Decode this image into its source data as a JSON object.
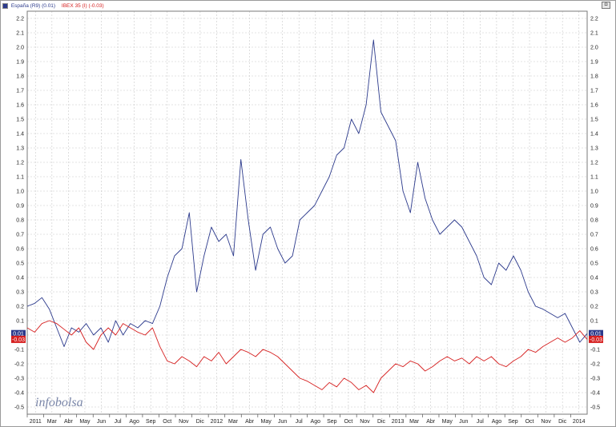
{
  "legend": {
    "spain_label": "España (R9) (0.01)",
    "ibex_label": "IBEX 35 (I) (-0.03)"
  },
  "watermark": "infobolsa",
  "window_button": "◘",
  "chart_data": {
    "type": "line",
    "title": "",
    "xlabel": "",
    "ylabel": "",
    "ylim": [
      -0.55,
      2.25
    ],
    "y_ticks": [
      "2.2",
      "2.1",
      "2.0",
      "1.9",
      "1.8",
      "1.7",
      "1.6",
      "1.5",
      "1.4",
      "1.3",
      "1.2",
      "1.1",
      "1.0",
      "0.9",
      "0.8",
      "0.7",
      "0.6",
      "0.5",
      "0.4",
      "0.3",
      "0.2",
      "0.1",
      "0.0",
      "-0.1",
      "-0.2",
      "-0.3",
      "-0.4",
      "-0.5"
    ],
    "x_ticks": [
      "2011",
      "Mar",
      "Abr",
      "May",
      "Jun",
      "Jul",
      "Ago",
      "Sep",
      "Oct",
      "Nov",
      "Dic",
      "2012",
      "Mar",
      "Abr",
      "May",
      "Jun",
      "Jul",
      "Ago",
      "Sep",
      "Oct",
      "Nov",
      "Dic",
      "2013",
      "Mar",
      "Abr",
      "May",
      "Jun",
      "Jul",
      "Ago",
      "Sep",
      "Oct",
      "Nov",
      "Dic",
      "2014"
    ],
    "grid": true,
    "legend_position": "top-left",
    "last_value_badges": {
      "spain": "0.01",
      "ibex": "-0.03"
    },
    "colors": {
      "spain": "#2c3a8c",
      "ibex": "#d62020",
      "grid": "#c8c8c8"
    },
    "series": [
      {
        "name": "España (R9)",
        "key": "spain",
        "points": [
          [
            0,
            0.2
          ],
          [
            1,
            0.22
          ],
          [
            2,
            0.26
          ],
          [
            3,
            0.18
          ],
          [
            4,
            0.05
          ],
          [
            5,
            -0.08
          ],
          [
            6,
            0.05
          ],
          [
            7,
            0.02
          ],
          [
            8,
            0.08
          ],
          [
            9,
            0.0
          ],
          [
            10,
            0.05
          ],
          [
            11,
            -0.05
          ],
          [
            12,
            0.1
          ],
          [
            13,
            0.0
          ],
          [
            14,
            0.08
          ],
          [
            15,
            0.05
          ],
          [
            16,
            0.1
          ],
          [
            17,
            0.08
          ],
          [
            18,
            0.2
          ],
          [
            19,
            0.4
          ],
          [
            20,
            0.55
          ],
          [
            21,
            0.6
          ],
          [
            22,
            0.85
          ],
          [
            23,
            0.3
          ],
          [
            24,
            0.55
          ],
          [
            25,
            0.75
          ],
          [
            26,
            0.65
          ],
          [
            27,
            0.7
          ],
          [
            28,
            0.55
          ],
          [
            29,
            1.22
          ],
          [
            30,
            0.8
          ],
          [
            31,
            0.45
          ],
          [
            32,
            0.7
          ],
          [
            33,
            0.75
          ],
          [
            34,
            0.6
          ],
          [
            35,
            0.5
          ],
          [
            36,
            0.55
          ],
          [
            37,
            0.8
          ],
          [
            38,
            0.85
          ],
          [
            39,
            0.9
          ],
          [
            40,
            1.0
          ],
          [
            41,
            1.1
          ],
          [
            42,
            1.25
          ],
          [
            43,
            1.3
          ],
          [
            44,
            1.5
          ],
          [
            45,
            1.4
          ],
          [
            46,
            1.6
          ],
          [
            47,
            2.05
          ],
          [
            48,
            1.55
          ],
          [
            49,
            1.45
          ],
          [
            50,
            1.35
          ],
          [
            51,
            1.0
          ],
          [
            52,
            0.85
          ],
          [
            53,
            1.2
          ],
          [
            54,
            0.95
          ],
          [
            55,
            0.8
          ],
          [
            56,
            0.7
          ],
          [
            57,
            0.75
          ],
          [
            58,
            0.8
          ],
          [
            59,
            0.75
          ],
          [
            60,
            0.65
          ],
          [
            61,
            0.55
          ],
          [
            62,
            0.4
          ],
          [
            63,
            0.35
          ],
          [
            64,
            0.5
          ],
          [
            65,
            0.45
          ],
          [
            66,
            0.55
          ],
          [
            67,
            0.45
          ],
          [
            68,
            0.3
          ],
          [
            69,
            0.2
          ],
          [
            70,
            0.18
          ],
          [
            71,
            0.15
          ],
          [
            72,
            0.12
          ],
          [
            73,
            0.15
          ],
          [
            74,
            0.05
          ],
          [
            75,
            -0.05
          ],
          [
            76,
            0.01
          ]
        ]
      },
      {
        "name": "IBEX 35",
        "key": "ibex",
        "points": [
          [
            0,
            0.05
          ],
          [
            1,
            0.02
          ],
          [
            2,
            0.08
          ],
          [
            3,
            0.1
          ],
          [
            4,
            0.08
          ],
          [
            5,
            0.04
          ],
          [
            6,
            0.0
          ],
          [
            7,
            0.05
          ],
          [
            8,
            -0.05
          ],
          [
            9,
            -0.1
          ],
          [
            10,
            0.0
          ],
          [
            11,
            0.05
          ],
          [
            12,
            0.0
          ],
          [
            13,
            0.08
          ],
          [
            14,
            0.05
          ],
          [
            15,
            0.02
          ],
          [
            16,
            0.0
          ],
          [
            17,
            0.05
          ],
          [
            18,
            -0.08
          ],
          [
            19,
            -0.18
          ],
          [
            20,
            -0.2
          ],
          [
            21,
            -0.15
          ],
          [
            22,
            -0.18
          ],
          [
            23,
            -0.22
          ],
          [
            24,
            -0.15
          ],
          [
            25,
            -0.18
          ],
          [
            26,
            -0.12
          ],
          [
            27,
            -0.2
          ],
          [
            28,
            -0.15
          ],
          [
            29,
            -0.1
          ],
          [
            30,
            -0.12
          ],
          [
            31,
            -0.15
          ],
          [
            32,
            -0.1
          ],
          [
            33,
            -0.12
          ],
          [
            34,
            -0.15
          ],
          [
            35,
            -0.2
          ],
          [
            36,
            -0.25
          ],
          [
            37,
            -0.3
          ],
          [
            38,
            -0.32
          ],
          [
            39,
            -0.35
          ],
          [
            40,
            -0.38
          ],
          [
            41,
            -0.33
          ],
          [
            42,
            -0.36
          ],
          [
            43,
            -0.3
          ],
          [
            44,
            -0.33
          ],
          [
            45,
            -0.38
          ],
          [
            46,
            -0.35
          ],
          [
            47,
            -0.4
          ],
          [
            48,
            -0.3
          ],
          [
            49,
            -0.25
          ],
          [
            50,
            -0.2
          ],
          [
            51,
            -0.22
          ],
          [
            52,
            -0.18
          ],
          [
            53,
            -0.2
          ],
          [
            54,
            -0.25
          ],
          [
            55,
            -0.22
          ],
          [
            56,
            -0.18
          ],
          [
            57,
            -0.15
          ],
          [
            58,
            -0.18
          ],
          [
            59,
            -0.16
          ],
          [
            60,
            -0.2
          ],
          [
            61,
            -0.15
          ],
          [
            62,
            -0.18
          ],
          [
            63,
            -0.15
          ],
          [
            64,
            -0.2
          ],
          [
            65,
            -0.22
          ],
          [
            66,
            -0.18
          ],
          [
            67,
            -0.15
          ],
          [
            68,
            -0.1
          ],
          [
            69,
            -0.12
          ],
          [
            70,
            -0.08
          ],
          [
            71,
            -0.05
          ],
          [
            72,
            -0.02
          ],
          [
            73,
            -0.05
          ],
          [
            74,
            -0.02
          ],
          [
            75,
            0.03
          ],
          [
            76,
            -0.03
          ]
        ]
      }
    ]
  }
}
